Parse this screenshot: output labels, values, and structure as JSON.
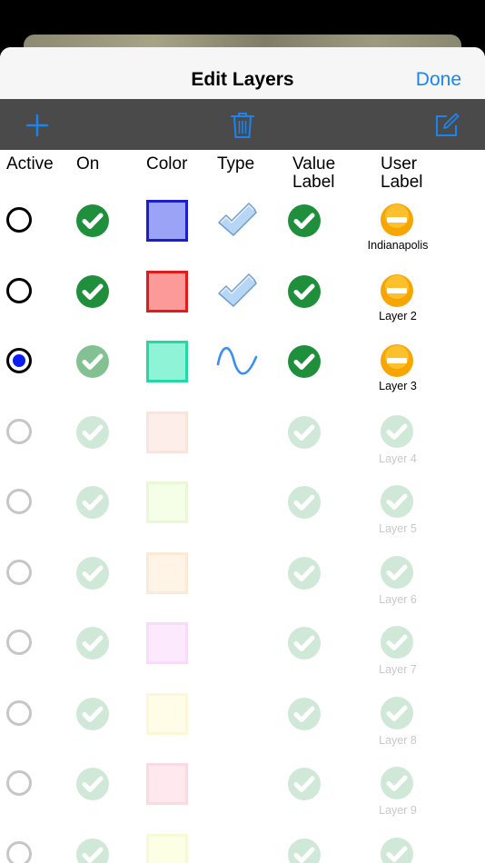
{
  "nav": {
    "title": "Edit Layers",
    "done_label": "Done"
  },
  "toolbar": {
    "add_icon": "plus-icon",
    "delete_icon": "trash-icon",
    "edit_icon": "compose-icon"
  },
  "headers": {
    "active": "Active",
    "on": "On",
    "color": "Color",
    "type": "Type",
    "value_label_1": "Value",
    "value_label_2": "Label",
    "user_label_1": "User",
    "user_label_2": "Label"
  },
  "colors": {
    "accent": "#1a84f0",
    "toolbar": "#4a4a4a",
    "check_green": "#1f8f3c",
    "minus_orange": "#f7a500"
  },
  "layers": [
    {
      "label": "Indianapolis",
      "active": false,
      "on": true,
      "type": "wrench",
      "value_label": true,
      "user_label": "minus",
      "color_fill": "#9aa3f5",
      "color_border": "#1a1fc8",
      "enabled": true
    },
    {
      "label": "Layer 2",
      "active": false,
      "on": true,
      "type": "wrench",
      "value_label": true,
      "user_label": "minus",
      "color_fill": "#fc9a9a",
      "color_border": "#e01b1b",
      "enabled": true
    },
    {
      "label": "Layer 3",
      "active": true,
      "on": true,
      "type": "wave",
      "value_label": true,
      "user_label": "minus",
      "color_fill": "#8ff3d8",
      "color_border": "#25d8a3",
      "enabled": true,
      "on_dim": true
    },
    {
      "label": "Layer 4",
      "active": false,
      "on": true,
      "type": "",
      "value_label": true,
      "user_label": "check",
      "color_fill": "#fbb49d",
      "color_border": "#f08a68",
      "enabled": false
    },
    {
      "label": "Layer 5",
      "active": false,
      "on": true,
      "type": "",
      "value_label": true,
      "user_label": "check",
      "color_fill": "#d6ff9a",
      "color_border": "#a4e04d",
      "enabled": false
    },
    {
      "label": "Layer 6",
      "active": false,
      "on": true,
      "type": "",
      "value_label": true,
      "user_label": "check",
      "color_fill": "#ffce8f",
      "color_border": "#f4a44b",
      "enabled": false
    },
    {
      "label": "Layer 7",
      "active": false,
      "on": true,
      "type": "",
      "value_label": true,
      "user_label": "check",
      "color_fill": "#f59ef7",
      "color_border": "#e35ae6",
      "enabled": false
    },
    {
      "label": "Layer 8",
      "active": false,
      "on": true,
      "type": "",
      "value_label": true,
      "user_label": "check",
      "color_fill": "#fff39a",
      "color_border": "#f3df4f",
      "enabled": false
    },
    {
      "label": "Layer 9",
      "active": false,
      "on": true,
      "type": "",
      "value_label": true,
      "user_label": "check",
      "color_fill": "#ff9fb8",
      "color_border": "#f0617f",
      "enabled": false
    },
    {
      "label": "",
      "active": false,
      "on": true,
      "type": "",
      "value_label": true,
      "user_label": "check",
      "color_fill": "#f8ff8a",
      "color_border": "#dbe94a",
      "enabled": false
    }
  ]
}
